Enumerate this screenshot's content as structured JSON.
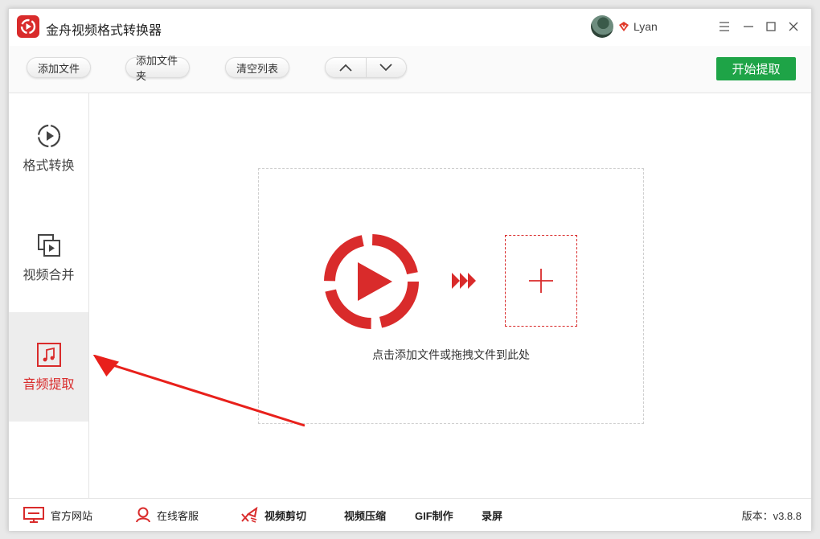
{
  "app": {
    "title": "金舟视频格式转换器",
    "username": "Lyan",
    "accent_color": "#d92b2b",
    "start_color": "#1ea447"
  },
  "window_controls": {
    "menu_icon": "☰",
    "minimize_icon": "—",
    "maximize_icon": "☐",
    "close_icon": "✕"
  },
  "toolbar": {
    "add_file": "添加文件",
    "add_folder": "添加文件夹",
    "clear_list": "清空列表",
    "start": "开始提取"
  },
  "sidebar": {
    "items": [
      {
        "label": "格式转换",
        "icon": "play-circle-icon"
      },
      {
        "label": "视频合并",
        "icon": "video-merge-icon"
      },
      {
        "label": "音频提取",
        "icon": "music-note-icon",
        "active": true
      }
    ]
  },
  "main": {
    "drop_hint": "点击添加文件或拖拽文件到此处"
  },
  "footer": {
    "links": [
      {
        "label": "官方网站",
        "icon": "monitor-icon"
      },
      {
        "label": "在线客服",
        "icon": "user-service-icon"
      },
      {
        "label": "视频剪切",
        "icon": "scissors-icon"
      },
      {
        "label": "视频压缩"
      },
      {
        "label": "GIF制作"
      },
      {
        "label": "录屏"
      }
    ],
    "version": "版本：v3.8.8"
  }
}
